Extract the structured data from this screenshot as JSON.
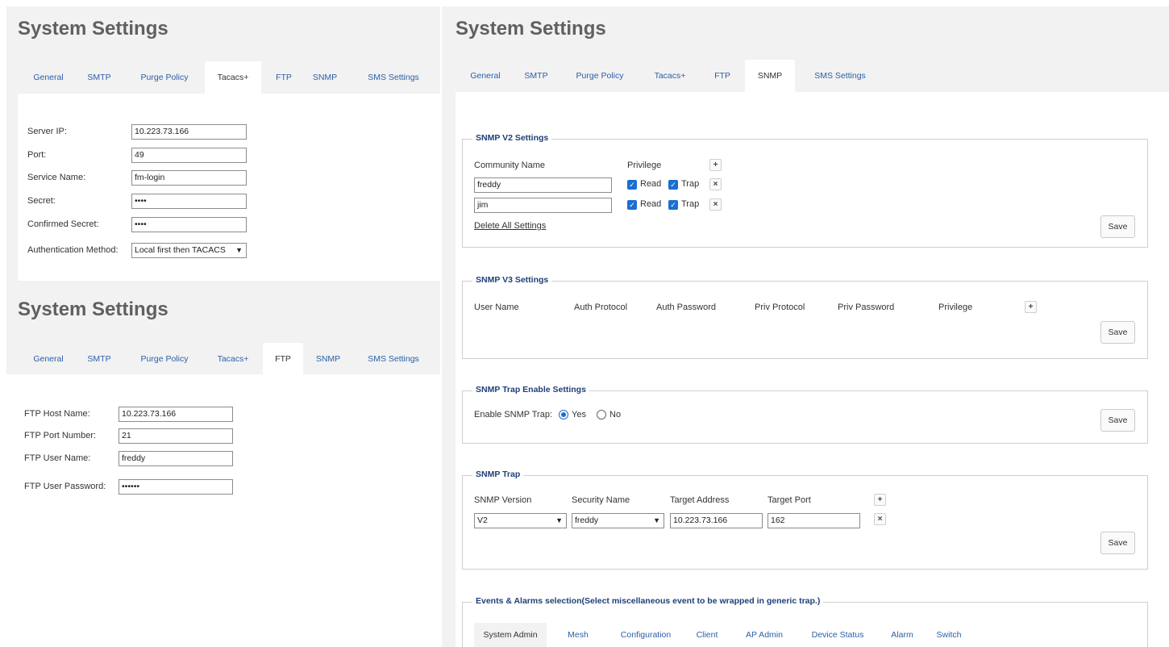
{
  "tabs": [
    "General",
    "SMTP",
    "Purge Policy",
    "Tacacs+",
    "FTP",
    "SNMP",
    "SMS Settings"
  ],
  "tacacs_panel": {
    "title": "System Settings",
    "active_tab": "Tacacs+",
    "fields": {
      "server_ip_label": "Server IP:",
      "server_ip_value": "10.223.73.166",
      "port_label": "Port:",
      "port_value": "49",
      "service_name_label": "Service Name:",
      "service_name_value": "fm-login",
      "secret_label": "Secret:",
      "secret_value": "••••",
      "confirmed_secret_label": "Confirmed Secret:",
      "confirmed_secret_value": "••••",
      "auth_method_label": "Authentication Method:",
      "auth_method_value": "Local first then TACACS"
    }
  },
  "ftp_panel": {
    "title": "System Settings",
    "active_tab": "FTP",
    "fields": {
      "host_label": "FTP Host Name:",
      "host_value": "10.223.73.166",
      "port_label": "FTP Port Number:",
      "port_value": "21",
      "user_label": "FTP User Name:",
      "user_value": "freddy",
      "password_label": "FTP User Password:",
      "password_value": "••••••"
    }
  },
  "snmp_panel": {
    "title": "System Settings",
    "active_tab": "SNMP",
    "v2": {
      "legend": "SNMP V2 Settings",
      "community_header": "Community Name",
      "privilege_header": "Privilege",
      "rows": [
        {
          "community": "freddy",
          "read_label": "Read",
          "trap_label": "Trap"
        },
        {
          "community": "jim",
          "read_label": "Read",
          "trap_label": "Trap"
        }
      ],
      "delete_all": "Delete All Settings",
      "save": "Save"
    },
    "v3": {
      "legend": "SNMP V3 Settings",
      "headers": [
        "User Name",
        "Auth Protocol",
        "Auth Password",
        "Priv Protocol",
        "Priv Password",
        "Privilege"
      ],
      "save": "Save"
    },
    "trap_enable": {
      "legend": "SNMP Trap Enable Settings",
      "label": "Enable SNMP Trap:",
      "yes": "Yes",
      "no": "No",
      "selected": "Yes",
      "save": "Save"
    },
    "trap": {
      "legend": "SNMP Trap",
      "headers": [
        "SNMP Version",
        "Security Name",
        "Target Address",
        "Target Port"
      ],
      "version": "V2",
      "security_name": "freddy",
      "target_address": "10.223.73.166",
      "target_port": "162",
      "save": "Save"
    },
    "events": {
      "legend": "Events & Alarms selection(Select miscellaneous event to be wrapped in generic trap.)",
      "tabs": [
        "System Admin",
        "Mesh",
        "Configuration",
        "Client",
        "AP Admin",
        "Device Status",
        "Alarm",
        "Switch"
      ],
      "active_tab": "System Admin"
    }
  },
  "colors": {
    "panel_bg": "#f2f2f2",
    "tab_link": "#2b5fa8",
    "legend": "#1f3f78",
    "checkbox": "#1a6fd0",
    "title": "#606060"
  },
  "icons": {
    "add": "+",
    "remove": "×",
    "check": "✓",
    "dropdown": "chevron-down-icon"
  }
}
